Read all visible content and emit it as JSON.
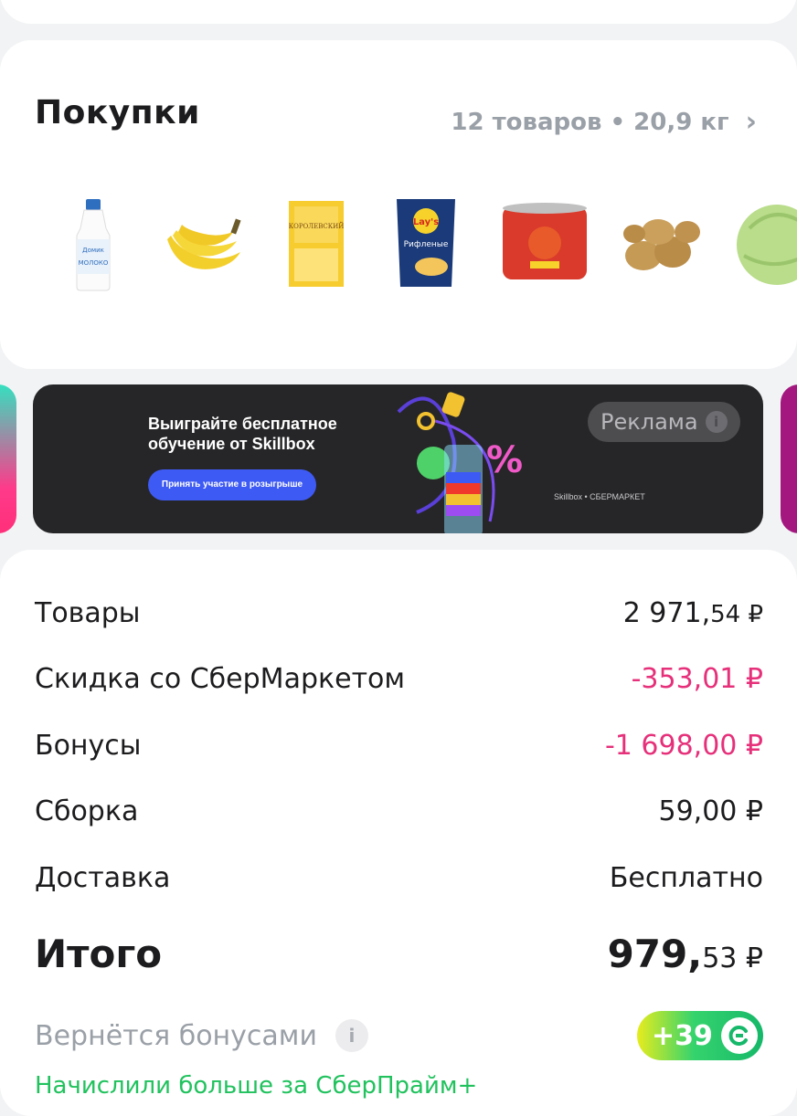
{
  "purchases": {
    "title": "Покупки",
    "meta": "12 товаров • 20,9 кг",
    "products": [
      "milk-bottle",
      "bananas",
      "cheese",
      "lays-chips",
      "tomato-paste",
      "potatoes",
      "cabbage"
    ]
  },
  "banner": {
    "title": "Выиграйте бесплатное обучение от Skillbox",
    "button": "Принять участие в розыгрыше",
    "ad_label": "Реклама",
    "brand": "Skillbox • СБЕРМАРКЕТ",
    "colors": {
      "bg": "#262628",
      "button": "#3e5af5"
    }
  },
  "summary": {
    "rows": [
      {
        "label": "Товары",
        "value_main": "2 971,",
        "value_minor": "54 ₽"
      },
      {
        "label": "Скидка со СберМаркетом",
        "value_main": "-353,01 ₽"
      },
      {
        "label": "Бонусы",
        "value_main": "-1 698,00 ₽"
      },
      {
        "label": "Сборка",
        "value_main": "59,00 ₽"
      },
      {
        "label": "Доставка",
        "value_main": "Бесплатно"
      }
    ],
    "total": {
      "label": "Итого",
      "value_main": "979,",
      "value_minor": "53 ₽"
    },
    "bonus_return": {
      "label": "Вернётся бонусами",
      "value": "+39"
    },
    "prime_note": "Начислили больше за СберПрайм+",
    "colors": {
      "discount": "#e6307a",
      "prime": "#21c25e"
    }
  }
}
